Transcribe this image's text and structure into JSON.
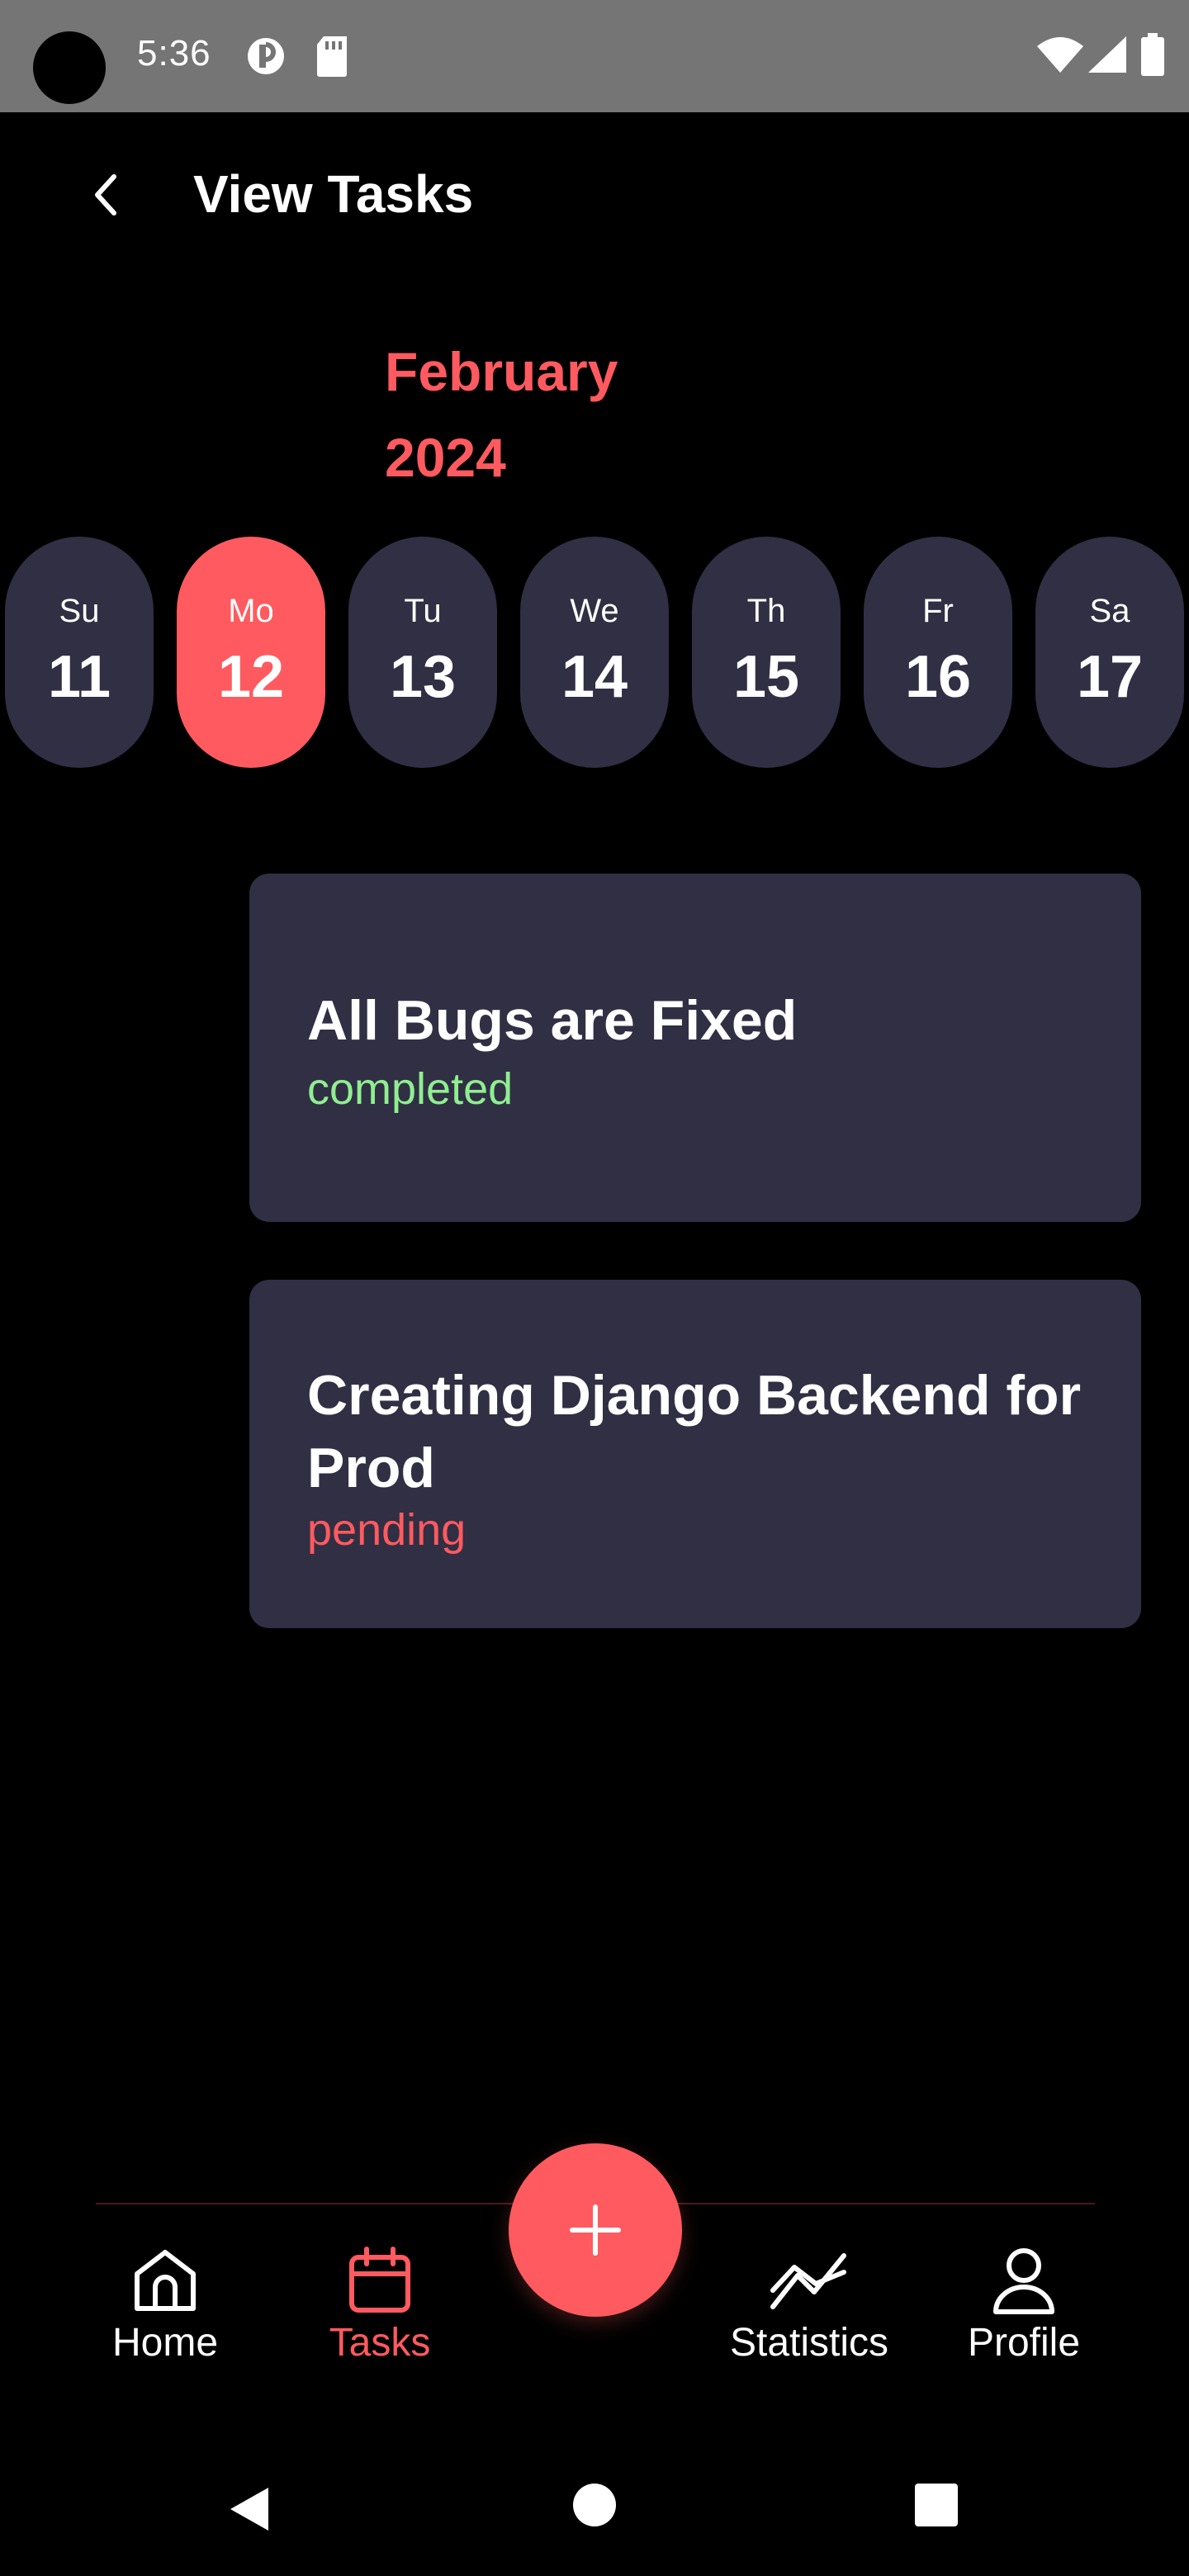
{
  "status_bar": {
    "time": "5:36"
  },
  "header": {
    "title": "View Tasks"
  },
  "calendar": {
    "month": "February",
    "year": "2024",
    "days": [
      {
        "dow": "Su",
        "num": "11"
      },
      {
        "dow": "Mo",
        "num": "12"
      },
      {
        "dow": "Tu",
        "num": "13"
      },
      {
        "dow": "We",
        "num": "14"
      },
      {
        "dow": "Th",
        "num": "15"
      },
      {
        "dow": "Fr",
        "num": "16"
      },
      {
        "dow": "Sa",
        "num": "17"
      }
    ],
    "selected_day": "12"
  },
  "tasks": [
    {
      "title": "All Bugs are Fixed",
      "status": "completed"
    },
    {
      "title": "Creating Django Backend for Prod",
      "status": "pending"
    }
  ],
  "colors": {
    "accent": "#ff5a5f",
    "card": "#302f44",
    "completed": "#90ee90",
    "pending": "#ff5a5f"
  },
  "bottom_nav": {
    "items": [
      {
        "label": "Home",
        "icon": "home-icon"
      },
      {
        "label": "Tasks",
        "icon": "calendar-icon"
      },
      {
        "label": "Statistics",
        "icon": "chart-icon"
      },
      {
        "label": "Profile",
        "icon": "person-icon"
      }
    ],
    "active": "Tasks",
    "fab_icon": "plus-icon"
  }
}
